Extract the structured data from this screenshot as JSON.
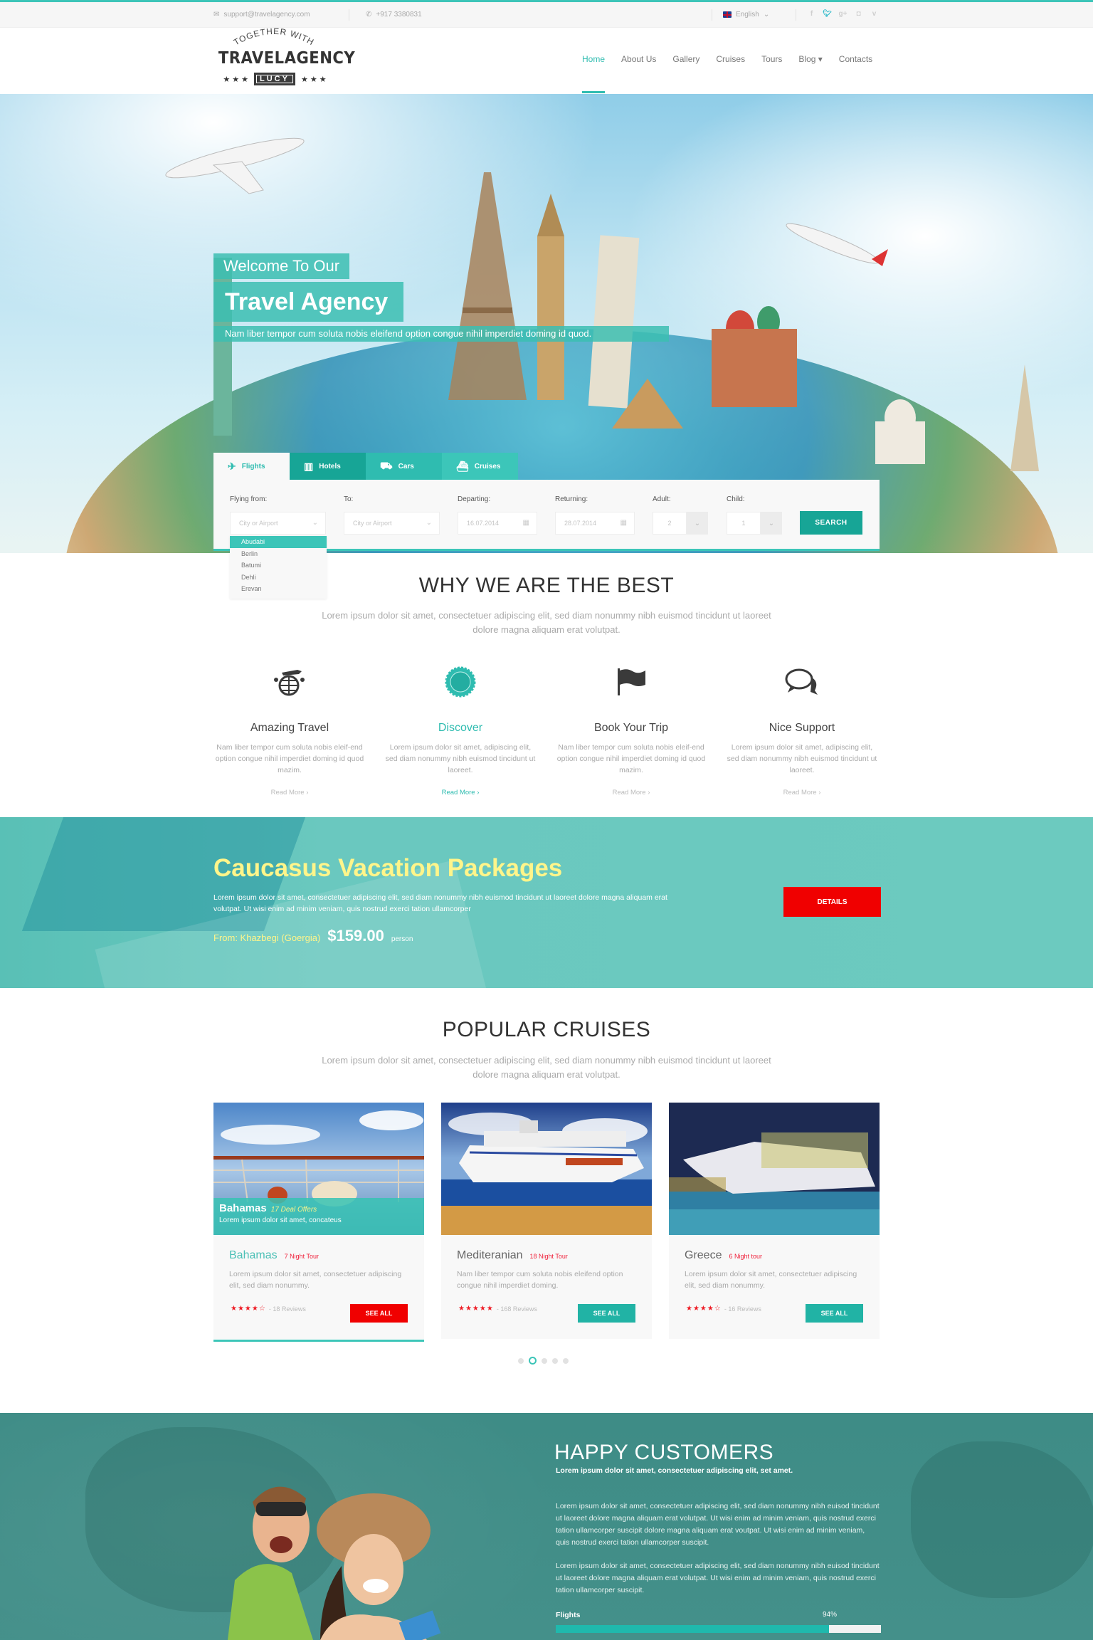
{
  "topbar": {
    "email": "support@travelagency.com",
    "phone": "+917 3380831",
    "language": "English",
    "social": [
      {
        "icon": "facebook-icon",
        "glyph": "f"
      },
      {
        "icon": "twitter-icon",
        "glyph": "t"
      },
      {
        "icon": "google-plus-icon",
        "glyph": "g+"
      },
      {
        "icon": "instagram-icon",
        "glyph": "◘"
      },
      {
        "icon": "vimeo-icon",
        "glyph": "v"
      }
    ]
  },
  "logo": {
    "tagline": "TOGETHER WITH",
    "name": "TRAVELAGENCY",
    "badge": "LUCY",
    "stars": "★ ★ ★"
  },
  "nav": {
    "items": [
      "Home",
      "About Us",
      "Gallery",
      "Cruises",
      "Tours",
      "Blog ▾",
      "Contacts"
    ],
    "active": "Home"
  },
  "hero": {
    "line1": "Welcome To Our",
    "line2": "Travel Agency",
    "line3": "Nam liber tempor cum soluta nobis eleifend option congue nihil imperdiet doming id quod."
  },
  "search": {
    "tabs": [
      {
        "label": "Flights",
        "icon": "✈"
      },
      {
        "label": "Hotels",
        "icon": "▥"
      },
      {
        "label": "Cars",
        "icon": "⛟"
      },
      {
        "label": "Cruises",
        "icon": "⛴"
      }
    ],
    "active_tab": "Flights",
    "fields": {
      "from": {
        "label": "Flying from:",
        "placeholder": "City or Airport"
      },
      "to": {
        "label": "To:",
        "placeholder": "City or Airport"
      },
      "departing": {
        "label": "Departing:",
        "value": "16.07.2014"
      },
      "returning": {
        "label": "Returning:",
        "value": "28.07.2014"
      },
      "adult": {
        "label": "Adult:",
        "value": "2"
      },
      "child": {
        "label": "Child:",
        "value": "1"
      }
    },
    "button": "SEARCH",
    "dropdown_options": [
      "Abudabi",
      "Berlin",
      "Batumi",
      "Dehli",
      "Erevan"
    ],
    "dropdown_selected": "Abudabi"
  },
  "why": {
    "title": "WHY WE ARE THE BEST",
    "subtitle": "Lorem ipsum dolor sit amet, consectetuer adipiscing elit, sed diam nonummy nibh euismod tincidunt ut laoreet dolore magna aliquam erat volutpat.",
    "features": [
      {
        "title": "Amazing Travel",
        "desc": "Nam liber tempor cum soluta nobis eleif-end option congue nihil imperdiet doming id quod mazim.",
        "more": "Read More ›",
        "icon": "globe-plane-icon"
      },
      {
        "title": "Discover",
        "desc": "Lorem ipsum dolor sit amet, adipiscing elit, sed diam nonummy nibh euismod tincidunt ut laoreet.",
        "more": "Read More ›",
        "icon": "badge-icon"
      },
      {
        "title": "Book Your Trip",
        "desc": "Nam liber tempor cum soluta nobis eleif-end option congue nihil imperdiet doming id quod mazim.",
        "more": "Read More ›",
        "icon": "flag-icon"
      },
      {
        "title": "Nice Support",
        "desc": "Lorem ipsum dolor sit amet, adipiscing elit, sed diam nonummy nibh euismod tincidunt ut laoreet.",
        "more": "Read More ›",
        "icon": "chat-icon"
      }
    ]
  },
  "promo": {
    "title": "Caucasus Vacation Packages",
    "text": "Lorem ipsum dolor sit amet, consectetuer adipiscing elit, sed diam nonummy nibh euismod tincidunt ut laoreet dolore magna aliquam erat volutpat. Ut wisi enim ad minim veniam, quis nostrud exerci tation ullamcorper",
    "from": "From: Khazbegi (Goergia)",
    "price": "$159.00",
    "per": "person",
    "button": "DETAILS"
  },
  "cruises": {
    "title": "POPULAR CRUISES",
    "subtitle": "Lorem ipsum dolor sit amet, consectetuer adipiscing elit, sed diam nonummy nibh euismod tincidunt ut laoreet dolore magna aliquam erat volutpat.",
    "cards": [
      {
        "name": "Bahamas",
        "nights": "7 Night Tour",
        "desc": "Lorem ipsum dolor sit amet, consectetuer adipiscing elit, sed diam nonummy.",
        "rating": 4,
        "stars": "★★★★☆",
        "reviews": "- 18 Reviews",
        "button": "SEE ALL",
        "overlay": {
          "title": "Bahamas",
          "deals": "17 Deal Offers",
          "text": "Lorem ipsum dolor sit amet, concateus"
        }
      },
      {
        "name": "Mediteranian",
        "nights": "18 Night Tour",
        "desc": "Nam liber tempor cum soluta nobis eleifend option congue nihil imperdiet doming.",
        "rating": 5,
        "stars": "★★★★★",
        "reviews": "- 168 Reviews",
        "button": "SEE ALL"
      },
      {
        "name": "Greece",
        "nights": "6 Night tour",
        "desc": "Lorem ipsum dolor sit amet, consectetuer adipiscing elit, sed diam nonummy.",
        "rating": 4,
        "stars": "★★★★☆",
        "reviews": "- 16 Reviews",
        "button": "SEE ALL"
      }
    ],
    "pagination": {
      "total": 5,
      "active": 2
    }
  },
  "happy": {
    "title": "HAPPY CUSTOMERS",
    "subtitle": "Lorem ipsum dolor sit amet, consectetuer adipiscing elit, set amet.",
    "p1": "Lorem ipsum dolor sit amet, consectetuer adipiscing elit, sed diam nonummy nibh euisod tincidunt ut laoreet dolore magna aliquam erat volutpat. Ut wisi enim ad minim veniam, quis nostrud exerci tation ullamcorper suscipit dolore magna aliquam erat voutpat. Ut wisi enim ad minim veniam, quis nostrud exerci tation ullamcorper suscipit.",
    "p2": "Lorem ipsum dolor sit amet, consectetuer adipiscing elit, sed diam nonummy nibh euisod tincidunt ut laoreet dolore magna aliquam erat volutpat. Ut wisi enim ad minim veniam, quis nostrud exerci tation ullamcorper suscipit.",
    "skill": {
      "label": "Flights",
      "value_text": "94%",
      "fill_percent": 84
    }
  },
  "colors": {
    "accent": "#3cc5b8",
    "accent_dark": "#17a596",
    "red": "#f00000",
    "promo_title": "#fff58a"
  }
}
